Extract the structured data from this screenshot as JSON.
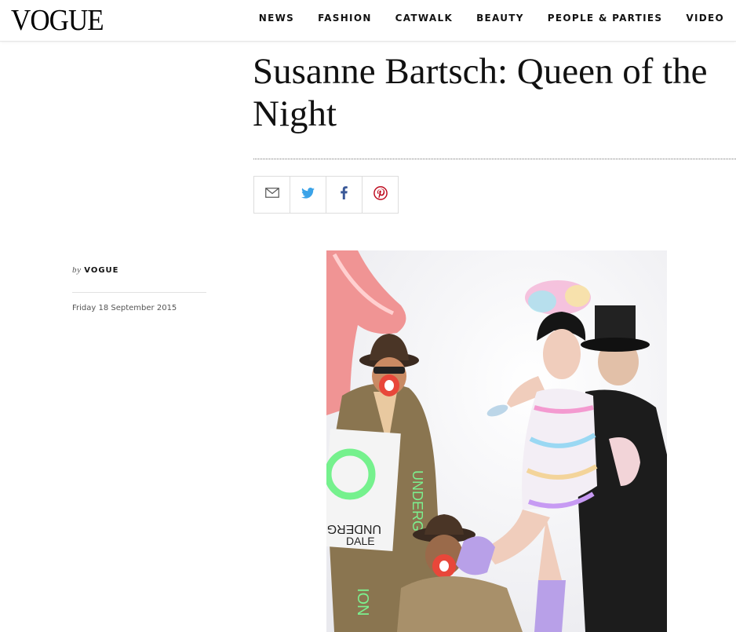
{
  "header": {
    "logo": "VOGUE",
    "nav": [
      "NEWS",
      "FASHION",
      "CATWALK",
      "BEAUTY",
      "PEOPLE & PARTIES",
      "VIDEO"
    ]
  },
  "article": {
    "title": "Susanne Bartsch: Queen of the Night",
    "byline_prefix": "by",
    "author": "VOGUE",
    "date": "Friday 18 September 2015"
  },
  "share": {
    "icons": [
      "mail-icon",
      "twitter-icon",
      "facebook-icon",
      "pinterest-icon"
    ],
    "colors": {
      "mail": "#555555",
      "twitter": "#3ba3e8",
      "facebook": "#3b5998",
      "pinterest": "#bd081c"
    }
  },
  "colors": {
    "text": "#111111",
    "rule": "#dddddd"
  }
}
